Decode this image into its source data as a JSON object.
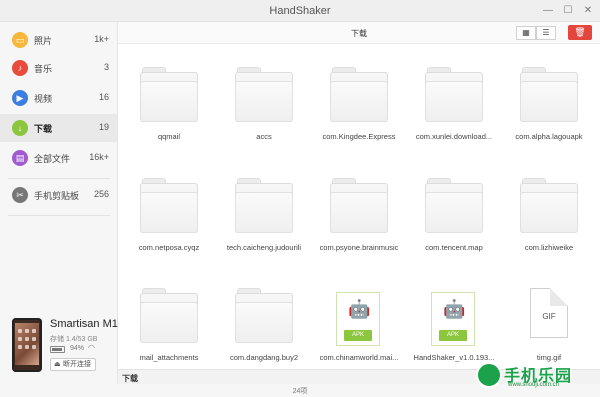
{
  "window": {
    "title": "HandShaker",
    "controls": [
      "minimize-icon",
      "maximize-icon",
      "close-icon"
    ]
  },
  "sidebar": {
    "items": [
      {
        "label": "照片",
        "count": "1k+",
        "icon": "photo-icon",
        "color": "#f6b73c",
        "active": false
      },
      {
        "label": "音乐",
        "count": "3",
        "icon": "music-icon",
        "color": "#e74c3c",
        "active": false
      },
      {
        "label": "视频",
        "count": "16",
        "icon": "video-icon",
        "color": "#3b7de0",
        "active": false
      },
      {
        "label": "下载",
        "count": "19",
        "icon": "download-icon",
        "color": "#8cc63f",
        "active": true
      },
      {
        "label": "全部文件",
        "count": "16k+",
        "icon": "files-icon",
        "color": "#a05ccf",
        "active": false
      },
      {
        "label": "手机剪贴板",
        "count": "256",
        "icon": "clipboard-icon",
        "color": "#777777",
        "active": false
      }
    ],
    "device": {
      "name": "Smartisan M1L",
      "storage": "存储 1.4/53 GB",
      "battery": "94%",
      "battery_level": 0.94,
      "disconnect_label": "断开连接"
    }
  },
  "toolbar": {
    "title": "下载",
    "grid_view_icon": "grid-icon",
    "list_view_icon": "list-icon",
    "delete_icon": "trash-icon",
    "accent": "#e4463e"
  },
  "files": [
    {
      "name": "qqmail",
      "type": "folder"
    },
    {
      "name": "accs",
      "type": "folder"
    },
    {
      "name": "com.Kingdee.Express",
      "type": "folder"
    },
    {
      "name": "com.xunlei.download...",
      "type": "folder"
    },
    {
      "name": "com.alpha.lagouapk",
      "type": "folder"
    },
    {
      "name": "com.netposa.cyqz",
      "type": "folder"
    },
    {
      "name": "tech.caicheng.judourili",
      "type": "folder"
    },
    {
      "name": "com.psyone.brainmusic",
      "type": "folder"
    },
    {
      "name": "com.tencent.map",
      "type": "folder"
    },
    {
      "name": "com.lizhiweike",
      "type": "folder"
    },
    {
      "name": "mail_attachments",
      "type": "folder"
    },
    {
      "name": "com.dangdang.buy2",
      "type": "folder"
    },
    {
      "name": "com.chinamworld.mai...",
      "type": "apk",
      "badge": "APK"
    },
    {
      "name": "HandShaker_v1.0.193...",
      "type": "apk",
      "badge": "APK"
    },
    {
      "name": "timg.gif",
      "type": "gif",
      "badge": "GIF"
    }
  ],
  "status": {
    "path": "下载",
    "count": "24项"
  },
  "watermark": {
    "text": "手机乐园",
    "url": "www.shouji.com.cn"
  }
}
